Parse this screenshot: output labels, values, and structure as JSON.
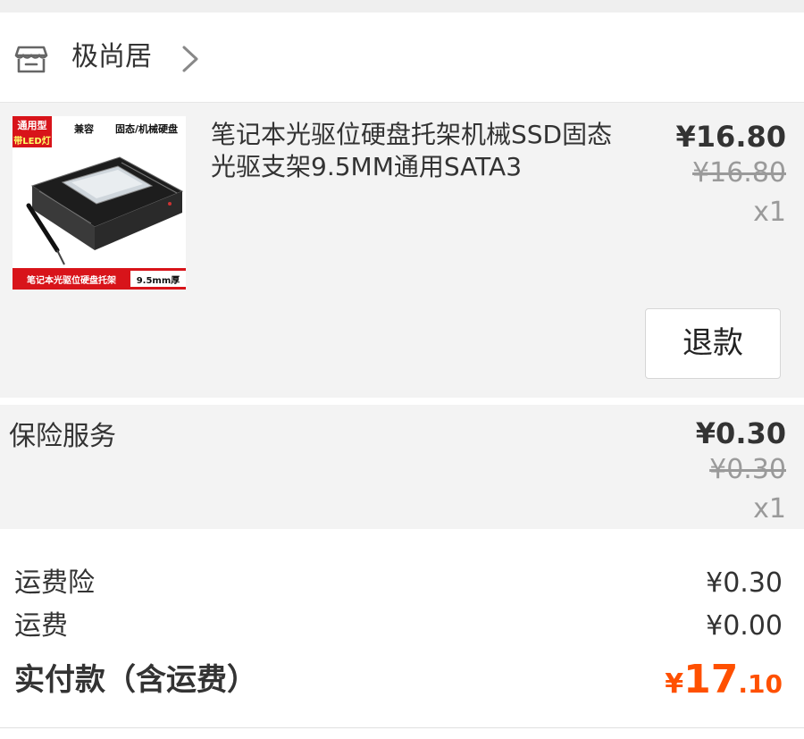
{
  "shop": {
    "name": "极尚居",
    "icon": "store-icon",
    "chevron_icon": "chevron-right-icon"
  },
  "product": {
    "title": "笔记本光驱位硬盘托架机械SSD固态光驱支架9.5MM通用SATA3",
    "price_now": "¥16.80",
    "price_original": "¥16.80",
    "quantity": "x1",
    "refund_label": "退款",
    "thumbnail": {
      "badge_top_left_line1": "通用型",
      "badge_top_left_line2": "带LED灯",
      "tag_compat": "兼容",
      "tag_types": "固态/机械硬盘",
      "caption_left": "笔记本光驱位硬盘托架",
      "caption_right": "9.5mm厚"
    }
  },
  "insurance": {
    "label": "保险服务",
    "price_now": "¥0.30",
    "price_original": "¥0.30",
    "quantity": "x1"
  },
  "summary": {
    "shipping_insurance_label": "运费险",
    "shipping_insurance_value": "¥0.30",
    "shipping_label": "运费",
    "shipping_value": "¥0.00",
    "total_label": "实付款（含运费）",
    "total_currency": "¥",
    "total_integer": "17",
    "total_decimal": ".10"
  },
  "colors": {
    "accent": "#ff5000",
    "badge_red": "#d8141a",
    "muted": "#9a9a9a",
    "panel_bg": "#f3f3f3"
  }
}
